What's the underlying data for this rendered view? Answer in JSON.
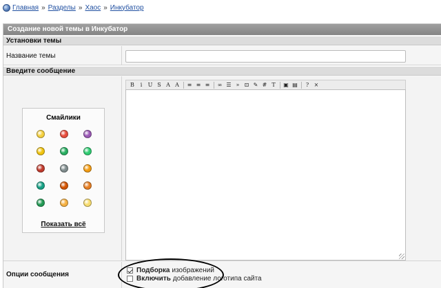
{
  "breadcrumb": {
    "items": [
      "Главная",
      "Разделы",
      "Хаос",
      "Инкубатор"
    ],
    "separator": "»"
  },
  "panel": {
    "title": "Создание новой темы в Инкубатор"
  },
  "settings": {
    "heading": "Установки темы",
    "topic_label": "Название темы",
    "topic_value": ""
  },
  "message": {
    "heading": "Введите сообщение",
    "body": ""
  },
  "smilies": {
    "title": "Смайлики",
    "show_all": "Показать всё",
    "items": [
      "grin-smiley-icon",
      "love-smiley-icon",
      "purple-smiley-icon",
      "thinking-smiley-icon",
      "arrow-smiley-icon",
      "green-smiley-icon",
      "gun-smiley-icon",
      "ghost-smiley-icon",
      "guitar-smiley-icon",
      "dizzy-smiley-icon",
      "dance-smiley-icon",
      "party-smiley-icon",
      "sad-smiley-icon",
      "laugh-smiley-icon",
      "star-smiley-icon"
    ]
  },
  "toolbar": {
    "buttons": [
      {
        "name": "bold-button",
        "glyph": "B"
      },
      {
        "name": "italic-button",
        "glyph": "i"
      },
      {
        "name": "underline-button",
        "glyph": "U"
      },
      {
        "name": "strike-button",
        "glyph": "S"
      },
      {
        "name": "font-color-button",
        "glyph": "A"
      },
      {
        "name": "font-size-button",
        "glyph": "A"
      },
      {
        "sep": true
      },
      {
        "name": "align-left-button",
        "glyph": "≡"
      },
      {
        "name": "align-center-button",
        "glyph": "≡"
      },
      {
        "name": "align-right-button",
        "glyph": "≡"
      },
      {
        "sep": true
      },
      {
        "name": "link-button",
        "glyph": "∞"
      },
      {
        "name": "list-button",
        "glyph": "☰"
      },
      {
        "name": "quote-button",
        "glyph": "»"
      },
      {
        "name": "html-button",
        "glyph": "⊡"
      },
      {
        "name": "spoiler-button",
        "glyph": "✎"
      },
      {
        "name": "hash-button",
        "glyph": "#"
      },
      {
        "name": "typewriter-button",
        "glyph": "T"
      },
      {
        "sep": true
      },
      {
        "name": "image-button",
        "glyph": "▣"
      },
      {
        "name": "video-button",
        "glyph": "▤"
      },
      {
        "sep": true
      },
      {
        "name": "help-button",
        "glyph": "?"
      },
      {
        "name": "remove-format-button",
        "glyph": "×"
      }
    ]
  },
  "options": {
    "label": "Опции сообщения",
    "items": [
      {
        "bold": "Подборка",
        "text": "изображений",
        "checked": true
      },
      {
        "bold": "Включить",
        "text": "добавление логотипа сайта",
        "checked": false
      }
    ]
  },
  "colors": {
    "title_bar": "#8f8f8f",
    "section_head": "#dcdcdc",
    "link": "#1e4ea0"
  }
}
